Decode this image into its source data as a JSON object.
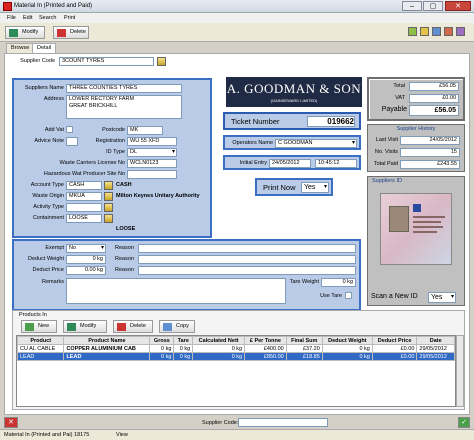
{
  "window": {
    "title": "Material In (Printed and Paid)"
  },
  "menu": [
    "File",
    "Edit",
    "Search",
    "Print"
  ],
  "toolbar": {
    "modify": "Modify",
    "delete": "Delete"
  },
  "tabs": [
    "Browse",
    "Detail"
  ],
  "supplier_code": {
    "label": "Supplier Code",
    "value": "3COUNT TYRES"
  },
  "supplier": {
    "name_label": "Suppliers Name",
    "name": "THREE COUNTIES TYRES",
    "address_label": "Address",
    "address": [
      "LOWER RECTORY FARM",
      "GREAT BRICKHILL"
    ],
    "add_vat_label": "Add Vat",
    "advice_note_label": "Advice Note",
    "postcode_label": "Postcode",
    "postcode": "MK",
    "registration_label": "Registration",
    "registration": "WU 55 XFD",
    "id_type_label": "ID Type",
    "id_type": "DL",
    "waste_carriers_label": "Waste Carriers License No",
    "waste_carriers": "WCLN0123",
    "haz_label": "Hazardous Wat Producer Site No",
    "haz": "",
    "account_type_label": "Account Type",
    "account_type": "CASH",
    "account_type_desc": "CASH",
    "waste_origin_label": "Waste Origin",
    "waste_origin": "MKUA",
    "waste_origin_desc": "Milton Keynes Unitary Authority",
    "activity_type_label": "Activity Type",
    "activity_type": "",
    "containment_label": "Containment",
    "containment": "LOOSE",
    "containment_desc": "LOOSE"
  },
  "company": {
    "name": "A. GOODMAN & SON",
    "sub": "(GAINSEWARD LIMITED)"
  },
  "ticket": {
    "label": "Ticket Number",
    "value": "019662"
  },
  "operator": {
    "label": "Operators Name",
    "value": "C GOODMAN"
  },
  "entry": {
    "label": "Initial Entry",
    "date": "24/05/2012",
    "time": "10:45:12"
  },
  "print_now": {
    "label": "Print Now",
    "value": "Yes"
  },
  "totals": {
    "total_label": "Total",
    "total": "£56.05",
    "vat_label": "VAT",
    "vat": "£0.00",
    "payable_label": "Payable",
    "payable": "£56.05"
  },
  "history": {
    "title": "Supplier History",
    "last_visit_label": "Last Visit",
    "last_visit": "24/05/2012",
    "visits_label": "No. Visits",
    "visits": "15",
    "total_paid_label": "Total Paid",
    "total_paid": "£243.55"
  },
  "suppliers_id": {
    "title": "Suppliers ID",
    "scan_label": "Scan a New ID",
    "scan_value": "Yes"
  },
  "middle": {
    "exempt_label": "Exempt",
    "exempt": "No",
    "reason1_label": "Reason",
    "deduct_weight_label": "Deduct Weight",
    "deduct_weight": "0 kg",
    "reason2_label": "Reason",
    "deduct_price_label": "Deduct Price",
    "deduct_price": "0.00 kg",
    "reason3_label": "Reason",
    "remarks_label": "Remarks",
    "tare_label": "Tare Weight",
    "tare": "0 kg",
    "use_tare_label": "Use Tare"
  },
  "products": {
    "title": "Products In",
    "buttons": {
      "new": "New",
      "modify": "Modify",
      "delete": "Delete",
      "copy": "Copy"
    },
    "columns": [
      "Product",
      "Product Name",
      "Gross",
      "Tare",
      "Calculated Nett",
      "£ Per Tonne",
      "Final Sum",
      "Deduct Weight",
      "Deduct Price",
      "Date"
    ],
    "rows": [
      [
        "CU AL CABLE",
        "COPPER ALUMINIUM CAB",
        "0 kg",
        "0 kg",
        "0 kg",
        "£400.00",
        "£37.20",
        "0 kg",
        "£0.00",
        "29/05/2012"
      ],
      [
        "LEAD",
        "LEAD",
        "0 kg",
        "0 kg",
        "0 kg",
        "£850.00",
        "£18.85",
        "0 kg",
        "£0.00",
        "29/05/2012"
      ]
    ]
  },
  "bottom": {
    "supplier_code_label": "Supplier Code:"
  },
  "status": {
    "left": "Material In (Printed and Pai) 18175",
    "right": "View"
  },
  "colors": {
    "accent_blue": "#3a6fc4",
    "panel_blue": "#b9cbe6",
    "selected_row": "#316ac5",
    "brand_dark": "#1f2a44"
  }
}
